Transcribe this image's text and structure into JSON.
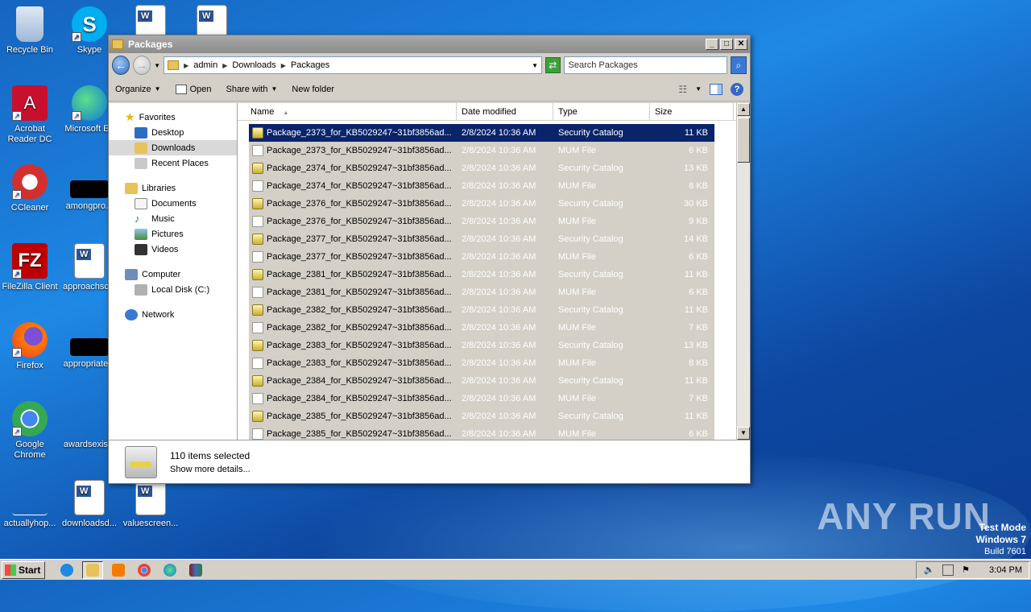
{
  "desktop": {
    "icons": [
      {
        "label": "Recycle Bin"
      },
      {
        "label": "Skype"
      },
      {
        "label": "Acrobat Reader DC"
      },
      {
        "label": "Microsoft Ed"
      },
      {
        "label": "CCleaner"
      },
      {
        "label": "amongpro..."
      },
      {
        "label": "FileZilla Client"
      },
      {
        "label": "approachsc..."
      },
      {
        "label": "Firefox"
      },
      {
        "label": "appropriate..."
      },
      {
        "label": "Google Chrome"
      },
      {
        "label": "awardsexis..."
      },
      {
        "label": "actuallyhop..."
      },
      {
        "label": "downloadsd..."
      },
      {
        "label": "valuescreen..."
      }
    ],
    "watermark": "ANY RUN",
    "test_mode": {
      "line1": "Test Mode",
      "line2": "Windows 7",
      "line3": "Build 7601"
    }
  },
  "window": {
    "title": "Packages",
    "breadcrumb": [
      "admin",
      "Downloads",
      "Packages"
    ],
    "search_placeholder": "Search Packages",
    "toolbar": {
      "organize": "Organize",
      "open": "Open",
      "share_with": "Share with",
      "new_folder": "New folder"
    },
    "nav": {
      "favorites": "Favorites",
      "desktop": "Desktop",
      "downloads": "Downloads",
      "recent": "Recent Places",
      "libraries": "Libraries",
      "documents": "Documents",
      "music": "Music",
      "pictures": "Pictures",
      "videos": "Videos",
      "computer": "Computer",
      "local_disk": "Local Disk (C:)",
      "network": "Network"
    },
    "columns": {
      "name": "Name",
      "date": "Date modified",
      "type": "Type",
      "size": "Size"
    },
    "files": [
      {
        "name": "Package_2373_for_KB5029247~31bf3856ad...",
        "date": "2/8/2024 10:36 AM",
        "type": "Security Catalog",
        "size": "11 KB"
      },
      {
        "name": "Package_2373_for_KB5029247~31bf3856ad...",
        "date": "2/8/2024 10:36 AM",
        "type": "MUM File",
        "size": "6 KB"
      },
      {
        "name": "Package_2374_for_KB5029247~31bf3856ad...",
        "date": "2/8/2024 10:36 AM",
        "type": "Security Catalog",
        "size": "13 KB"
      },
      {
        "name": "Package_2374_for_KB5029247~31bf3856ad...",
        "date": "2/8/2024 10:36 AM",
        "type": "MUM File",
        "size": "8 KB"
      },
      {
        "name": "Package_2376_for_KB5029247~31bf3856ad...",
        "date": "2/8/2024 10:36 AM",
        "type": "Security Catalog",
        "size": "30 KB"
      },
      {
        "name": "Package_2376_for_KB5029247~31bf3856ad...",
        "date": "2/8/2024 10:36 AM",
        "type": "MUM File",
        "size": "9 KB"
      },
      {
        "name": "Package_2377_for_KB5029247~31bf3856ad...",
        "date": "2/8/2024 10:36 AM",
        "type": "Security Catalog",
        "size": "14 KB"
      },
      {
        "name": "Package_2377_for_KB5029247~31bf3856ad...",
        "date": "2/8/2024 10:36 AM",
        "type": "MUM File",
        "size": "6 KB"
      },
      {
        "name": "Package_2381_for_KB5029247~31bf3856ad...",
        "date": "2/8/2024 10:36 AM",
        "type": "Security Catalog",
        "size": "11 KB"
      },
      {
        "name": "Package_2381_for_KB5029247~31bf3856ad...",
        "date": "2/8/2024 10:36 AM",
        "type": "MUM File",
        "size": "6 KB"
      },
      {
        "name": "Package_2382_for_KB5029247~31bf3856ad...",
        "date": "2/8/2024 10:36 AM",
        "type": "Security Catalog",
        "size": "11 KB"
      },
      {
        "name": "Package_2382_for_KB5029247~31bf3856ad...",
        "date": "2/8/2024 10:36 AM",
        "type": "MUM File",
        "size": "7 KB"
      },
      {
        "name": "Package_2383_for_KB5029247~31bf3856ad...",
        "date": "2/8/2024 10:36 AM",
        "type": "Security Catalog",
        "size": "13 KB"
      },
      {
        "name": "Package_2383_for_KB5029247~31bf3856ad...",
        "date": "2/8/2024 10:36 AM",
        "type": "MUM File",
        "size": "8 KB"
      },
      {
        "name": "Package_2384_for_KB5029247~31bf3856ad...",
        "date": "2/8/2024 10:36 AM",
        "type": "Security Catalog",
        "size": "11 KB"
      },
      {
        "name": "Package_2384_for_KB5029247~31bf3856ad...",
        "date": "2/8/2024 10:36 AM",
        "type": "MUM File",
        "size": "7 KB"
      },
      {
        "name": "Package_2385_for_KB5029247~31bf3856ad...",
        "date": "2/8/2024 10:36 AM",
        "type": "Security Catalog",
        "size": "11 KB"
      },
      {
        "name": "Package_2385_for_KB5029247~31bf3856ad...",
        "date": "2/8/2024 10:36 AM",
        "type": "MUM File",
        "size": "6 KB"
      }
    ],
    "details": {
      "count": "110 items selected",
      "more": "Show more details..."
    }
  },
  "taskbar": {
    "start": "Start",
    "clock": "3:04 PM"
  }
}
